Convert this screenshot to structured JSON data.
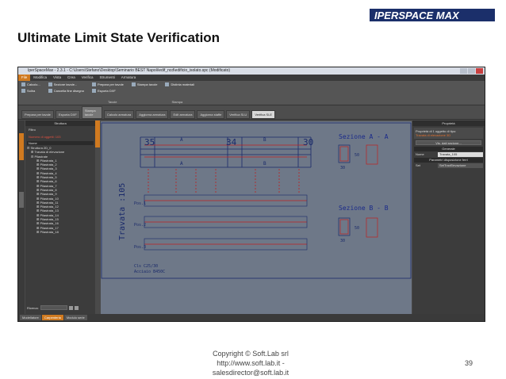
{
  "slide": {
    "title": "Ultimate Limit State Verification",
    "copyright": "Copyright © Soft.Lab srl",
    "url": "http://www.soft.lab.it -",
    "email": "salesdirector@soft.lab.it",
    "page_number": "39"
  },
  "logo": {
    "text": "IPERSPACE MAX"
  },
  "app": {
    "window_title": "IperSpaceMax - 2.3.1 - C:\\Users\\Stefano\\Desktop\\Seminario BEST Napoli\\edif_ncd\\edificio_isolato.spc (Modificato)",
    "menu": [
      "File",
      "Modifica",
      "Vista",
      "Crea",
      "Verifica",
      "Strumenti",
      "Armatura"
    ],
    "active_menu": "File",
    "ribbon": {
      "group1": [
        "Calcolo...",
        "Sollra"
      ],
      "group2": [
        "Sezione tavole...",
        "Cancella fine disegno"
      ],
      "group3": [
        "Prepara per tavole",
        "Esporta DXF"
      ],
      "group3_extra": "Stampa tavole",
      "group4": [
        "Distinta materiali"
      ],
      "group_label_tavole": "Tavole",
      "group_label_stampa": "Stampa"
    },
    "toolbar_tabs": [
      "Prepara per tavole",
      "Esporta DXF",
      "Stampa tavole",
      "Calcolo armatura",
      "Aggiorna armatura",
      "Edit armatura",
      "Aggiorna staffe",
      "Verifica SLU",
      "Verifica SLE"
    ],
    "active_toolbar_tab": "Verifica SLE",
    "tree": {
      "header": "Struttura",
      "filter_label": "Filtro",
      "count_label": "Numero di oggetti: 103",
      "column_header": "Nome",
      "items": [
        "Struttura 2D_0",
        "Travata di elevazione",
        "Pilastrate",
        "Pilastrata_1",
        "Pilastrata_2",
        "Pilastrata_3",
        "Pilastrata_4",
        "Pilastrata_5",
        "Pilastrata_6",
        "Pilastrata_7",
        "Pilastrata_8",
        "Pilastrata_9",
        "Pilastrata_10",
        "Pilastrata_11",
        "Pilastrata_12",
        "Pilastrata_13",
        "Pilastrata_14",
        "Pilastrata_15",
        "Pilastrata_16",
        "Pilastrata_17",
        "Pilastrata_18"
      ],
      "search_label": "Ricerca:"
    },
    "side_tabs": [
      "Struttura",
      "Selezione",
      "Vista"
    ],
    "properties": {
      "header": "Proprietà",
      "selection_text": "Proprietà di 1 oggetto di tipo:",
      "selection_type": "Travata di elevazione 3D",
      "view_button": "Vis. dati sezione...",
      "section_general": "Generale",
      "name_key": "Nome",
      "name_value": "Travata_105",
      "section_params": "Parametri disposizione ferri",
      "set_key": "Set",
      "set_value": "SetTravElevazione"
    },
    "status_tabs": [
      "Modellatore",
      "Carpenteria",
      "Modulo serie"
    ],
    "active_status_tab": "Carpenteria"
  },
  "drawing": {
    "title_vertical": "Travata :105",
    "dim_left": "35",
    "dim_mid": "34",
    "dim_right": "30",
    "label_a": "A",
    "label_b": "B",
    "pos_labels": [
      "Pos.1",
      "Pos.2",
      "Pos.3"
    ],
    "section_aa": "Sezione A - A",
    "section_bb": "Sezione B - B",
    "section_dim_w": "30",
    "section_dim_h": "50",
    "material_concrete": "Cls  C25/30",
    "material_steel": "Acciaio  B450C"
  },
  "colors": {
    "accent": "#d07a20",
    "canvas_bg": "#6e7888",
    "beam_line": "#1a2a6a",
    "rebar": "#c02020"
  }
}
